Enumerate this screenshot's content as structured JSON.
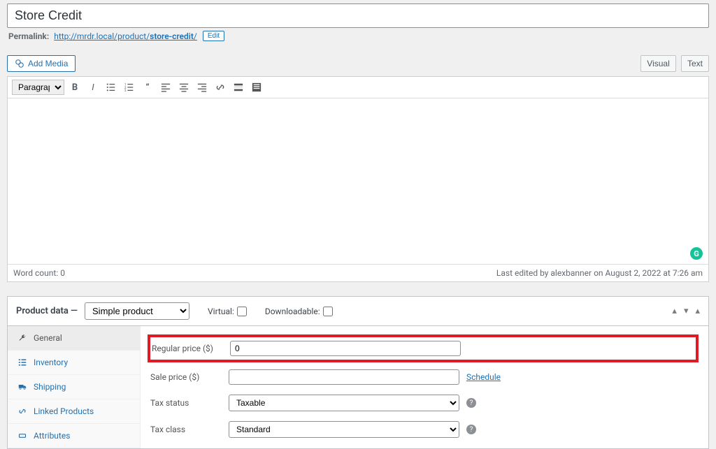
{
  "title": "Store Credit",
  "permalink": {
    "label": "Permalink:",
    "base": "http://mrdr.local/product/",
    "slug": "store-credit",
    "end": "/",
    "edit": "Edit"
  },
  "media_btn": "Add Media",
  "tabs": {
    "visual": "Visual",
    "text": "Text"
  },
  "block_format": "Paragraph",
  "word_count_label": "Word count:",
  "word_count": "0",
  "last_edited": "Last edited by alexbanner on August 2, 2022 at 7:26 am",
  "product_data": {
    "title": "Product data",
    "dash": "—",
    "type": "Simple product",
    "virtual_label": "Virtual:",
    "downloadable_label": "Downloadable:"
  },
  "side_tabs": [
    {
      "label": "General",
      "icon": "wrench"
    },
    {
      "label": "Inventory",
      "icon": "list"
    },
    {
      "label": "Shipping",
      "icon": "truck"
    },
    {
      "label": "Linked Products",
      "icon": "link"
    },
    {
      "label": "Attributes",
      "icon": "tag"
    }
  ],
  "fields": {
    "regular_price_label": "Regular price ($)",
    "regular_price_value": "0",
    "sale_price_label": "Sale price ($)",
    "sale_price_value": "",
    "schedule": "Schedule",
    "tax_status_label": "Tax status",
    "tax_status_value": "Taxable",
    "tax_class_label": "Tax class",
    "tax_class_value": "Standard"
  }
}
